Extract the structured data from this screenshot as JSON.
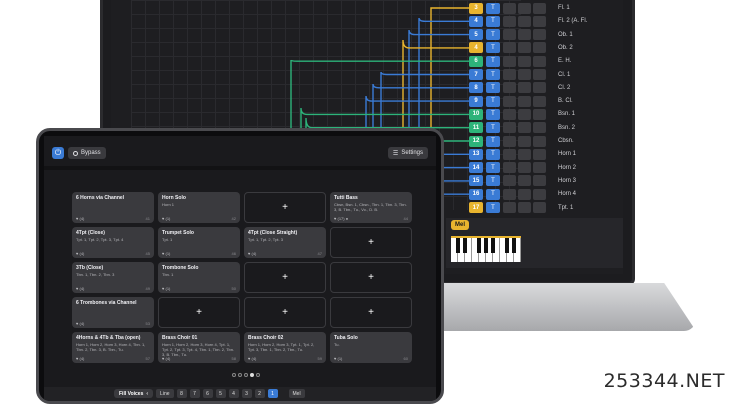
{
  "laptop": {
    "channels": [
      {
        "num": "3",
        "color": "#e8b42e",
        "label": "Fl. 1"
      },
      {
        "num": "4",
        "color": "#3a7bd5",
        "label": "Fl. 2 (A. Fl."
      },
      {
        "num": "5",
        "color": "#3a7bd5",
        "label": "Ob. 1"
      },
      {
        "num": "4",
        "color": "#e8b42e",
        "label": "Ob. 2"
      },
      {
        "num": "6",
        "color": "#2db37a",
        "label": "E. H."
      },
      {
        "num": "7",
        "color": "#3a7bd5",
        "label": "Cl. 1"
      },
      {
        "num": "8",
        "color": "#3a7bd5",
        "label": "Cl. 2"
      },
      {
        "num": "9",
        "color": "#3a7bd5",
        "label": "B. Cl."
      },
      {
        "num": "10",
        "color": "#2db37a",
        "label": "Bsn. 1"
      },
      {
        "num": "11",
        "color": "#2db37a",
        "label": "Bsn. 2"
      },
      {
        "num": "12",
        "color": "#2db37a",
        "label": "Cbsn."
      },
      {
        "num": "13",
        "color": "#3a7bd5",
        "label": "Horn 1"
      },
      {
        "num": "14",
        "color": "#3a7bd5",
        "label": "Horn 2"
      },
      {
        "num": "15",
        "color": "#3a7bd5",
        "label": "Horn 3"
      },
      {
        "num": "16",
        "color": "#3a7bd5",
        "label": "Horn 4"
      },
      {
        "num": "17",
        "color": "#e8b42e",
        "label": "Tpt. 1"
      }
    ],
    "t_label": "T",
    "mel": "Mel"
  },
  "tablet": {
    "bypass": "Bypass",
    "settings": "Settings",
    "cells": [
      {
        "title": "6 Horns via Channel",
        "sub": "",
        "foot": "♥ (4)",
        "num": "41"
      },
      {
        "title": "Horn Solo",
        "sub": "Horn 1",
        "foot": "♥ (1)",
        "num": "42"
      },
      {
        "empty": true
      },
      {
        "title": "Tutti Bass",
        "sub": "Cbsn, Bsn. 1, Cbsn., Tbn. 1, Tbn. 3, Tbn. 3, B. Tbn., Tu., Vc., D. B.",
        "foot": "♥ (17) ●",
        "num": "44"
      },
      {
        "title": "4Tpt (Close)",
        "sub": "Tpt. 1, Tpt. 2, Tpt. 3, Tpt. 4",
        "foot": "♥ (4)",
        "num": "45"
      },
      {
        "title": "Trumpet Solo",
        "sub": "Tpt. 1",
        "foot": "♥ (1)",
        "num": "46"
      },
      {
        "title": "4Tpt (Close Straight)",
        "sub": "Tpt. 1, Tpt. 2, Tpt. 3",
        "foot": "♥ (4)",
        "num": "47"
      },
      {
        "empty": true
      },
      {
        "title": "3Tb (Close)",
        "sub": "Tbn. 1, Tbn. 2, Tbn. 3",
        "foot": "♥ (4)",
        "num": "49"
      },
      {
        "title": "Trombone Solo",
        "sub": "Tbn. 1",
        "foot": "♥ (1)",
        "num": "50"
      },
      {
        "empty": true
      },
      {
        "empty": true
      },
      {
        "title": "6 Trombones via Channel",
        "sub": "",
        "foot": "♥ (4)",
        "num": "53"
      },
      {
        "empty": true
      },
      {
        "empty": true
      },
      {
        "empty": true
      },
      {
        "title": "4Horns & 4Tb & Tba (open)",
        "sub": "Horn 1, Horn 2, Horn 3, Horn 4, Tbn. 1, Tbn. 2, Tbn. 3, B. Tbn., Tu.",
        "foot": "♥ (4)",
        "num": "57"
      },
      {
        "title": "Brass Choir 01",
        "sub": "Horn 1, Horn 2, Horn 3, Horn 4, Tpt. 1, Tpt. 2, Tpt. 3, Tpt. 4, Tbn. 1, Tbn. 2, Tbn. 3, B. Tbn., Tu.",
        "foot": "♥ (4)",
        "num": "58"
      },
      {
        "title": "Brass Choir 02",
        "sub": "Horn 1, Horn 2, Horn 3, Tpt. 1, Tpt. 2, Tpt. 3, Tbn. 1, Tbn. 2, Tbn., Tu.",
        "foot": "♥ (4)",
        "num": "59"
      },
      {
        "title": "Tuba Solo",
        "sub": "Tu.",
        "foot": "♥ (1)",
        "num": "60"
      }
    ],
    "fill_voices": "Fill Voices",
    "line": "Line",
    "pages": [
      "8",
      "7",
      "6",
      "5",
      "4",
      "3",
      "2",
      "1"
    ],
    "mel": "Mel"
  },
  "watermark": "253344.NET"
}
